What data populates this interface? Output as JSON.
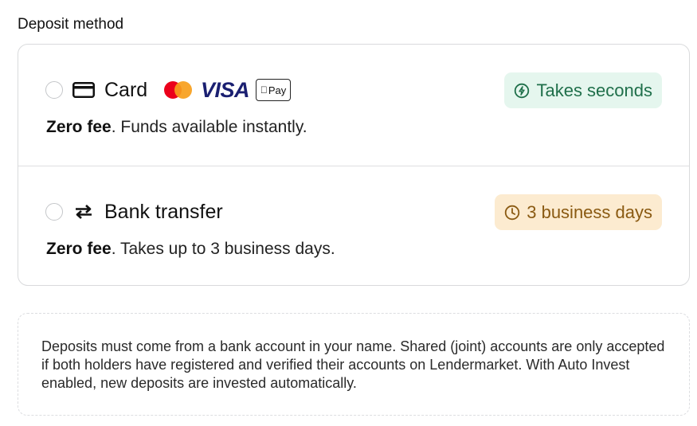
{
  "section": {
    "title": "Deposit method"
  },
  "methods": [
    {
      "label": "Card",
      "icon": "credit-card-icon",
      "brands": {
        "visa": "VISA",
        "apple_pay": "Pay"
      },
      "badge": {
        "text": "Takes seconds",
        "icon": "lightning-icon",
        "color": "#1f6f4a",
        "bg": "#e5f6ee"
      },
      "desc_bold": "Zero fee",
      "desc_rest": ". Funds available instantly."
    },
    {
      "label": "Bank transfer",
      "icon": "transfer-arrows-icon",
      "badge": {
        "text": "3 business days",
        "icon": "clock-icon",
        "color": "#8a5a12",
        "bg": "#fcebd0"
      },
      "desc_bold": "Zero fee",
      "desc_rest": ". Takes up to 3 business days."
    }
  ],
  "note": {
    "text": "Deposits must come from a bank account in your name. Shared (joint) accounts are only accepted if both holders have registered and verified their accounts on Lendermarket. With Auto Invest enabled, new deposits are invested automatically."
  }
}
